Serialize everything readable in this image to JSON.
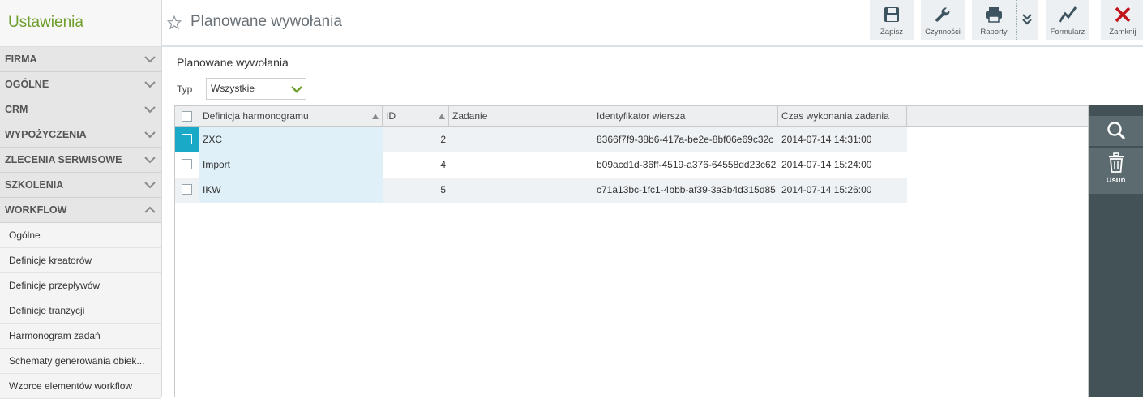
{
  "sidebar": {
    "title": "Ustawienia",
    "sections": [
      {
        "label": "FIRMA",
        "expanded": false
      },
      {
        "label": "OGÓLNE",
        "expanded": false
      },
      {
        "label": "CRM",
        "expanded": false
      },
      {
        "label": "WYPOŻYCZENIA",
        "expanded": false
      },
      {
        "label": "ZLECENIA SERWISOWE",
        "expanded": false
      },
      {
        "label": "SZKOLENIA",
        "expanded": false
      },
      {
        "label": "WORKFLOW",
        "expanded": true
      }
    ],
    "workflow_items": [
      "Ogólne",
      "Definicje kreatorów",
      "Definicje przepływów",
      "Definicje tranzycji",
      "Harmonogram zadań",
      "Schematy generowania obiek...",
      "Wzorce elementów workflow"
    ]
  },
  "header": {
    "title": "Planowane wywołania",
    "toolbar": {
      "save": "Zapisz",
      "actions": "Czynności",
      "reports": "Raporty",
      "form": "Formularz",
      "close": "Zamknij"
    }
  },
  "content": {
    "title": "Planowane wywołania",
    "filter": {
      "label": "Typ",
      "value": "Wszystkie"
    }
  },
  "grid": {
    "columns": [
      "Definicja harmonogramu",
      "ID",
      "Zadanie",
      "Identyfikator wiersza",
      "Czas wykonania zadania"
    ],
    "rows": [
      {
        "definition": "ZXC",
        "id": "2",
        "task": "",
        "row_id": "8366f7f9-38b6-417a-be2e-8bf06e69c32c",
        "time": "2014-07-14 14:31:00",
        "selected": true
      },
      {
        "definition": "Import",
        "id": "4",
        "task": "",
        "row_id": "b09acd1d-36ff-4519-a376-64558dd23c62",
        "time": "2014-07-14 15:24:00",
        "selected": false
      },
      {
        "definition": "IKW",
        "id": "5",
        "task": "",
        "row_id": "c71a13bc-1fc1-4bbb-af39-3a3b4d315d85",
        "time": "2014-07-14 15:26:00",
        "selected": false
      }
    ]
  },
  "actions_panel": {
    "search_icon": "magnifier-icon",
    "delete_label": "Usuń"
  },
  "colors": {
    "brand_green": "#6e9e2c",
    "selection_blue": "#1aa9c7",
    "panel_dark": "#425257",
    "close_red": "#c0141b"
  }
}
